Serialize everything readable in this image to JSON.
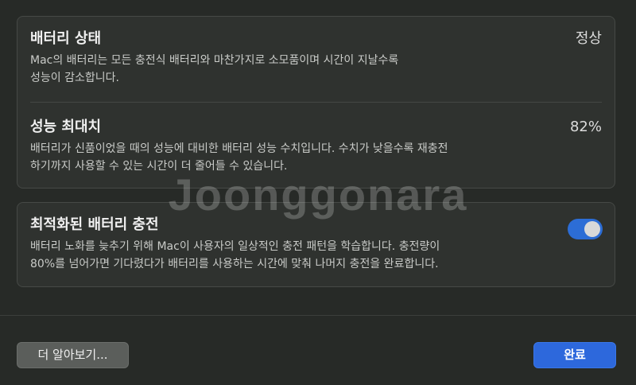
{
  "battery_health": {
    "title": "배터리 상태",
    "value": "정상",
    "description_line1": "Mac의 배터리는 모든 충전식 배터리와 마찬가지로 소모품이며 시간이 지날수록",
    "description_line2": "성능이 감소합니다."
  },
  "max_capacity": {
    "title": "성능 최대치",
    "value": "82%",
    "description_line1": "배터리가 신품이었을 때의 성능에 대비한 배터리 성능 수치입니다. 수치가 낮을수록 재충전",
    "description_line2": "하기까지 사용할 수 있는 시간이 더 줄어들 수 있습니다."
  },
  "optimized_charging": {
    "title": "최적화된 배터리 충전",
    "enabled": true,
    "description_line1": "배터리 노화를 늦추기 위해 Mac이 사용자의 일상적인 충전 패턴을 학습합니다. 충전량이",
    "description_line2": "80%를 넘어가면 기다렸다가 배터리를 사용하는 시간에 맞춰 나머지 충전을 완료합니다."
  },
  "buttons": {
    "learn_more": "더 알아보기...",
    "done": "완료"
  },
  "watermark": "Joonggonara",
  "colors": {
    "background": "#272a27",
    "card": "#2f322f",
    "accent": "#2d68dc",
    "toggle_on": "#2c6dd6"
  }
}
